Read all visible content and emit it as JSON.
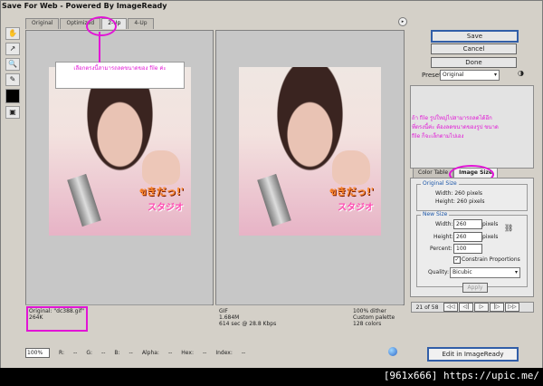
{
  "window": {
    "title": "Save For Web - Powered By ImageReady"
  },
  "tabs": [
    {
      "label": "Original"
    },
    {
      "label": "Optimized"
    },
    {
      "label": "2-Up"
    },
    {
      "label": "4-Up"
    }
  ],
  "buttons": {
    "save": "Save",
    "cancel": "Cancel",
    "done": "Done"
  },
  "preset": {
    "label": "Preset:",
    "value": "Original"
  },
  "annotations": {
    "left": "เลือกตรงนี้สามารถลดขนาดของ file ค่ะ",
    "right_lines": [
      "ถ้า file รูปใหญ่ไปสามารถลดได้อีก",
      "ที่ตรงนี้ค่ะ ต้องลดขนาดของรูป ขนาด",
      "file ก็จะเล็กตามไปเอง"
    ]
  },
  "left_image": {
    "overlay_text_1": "ขきだっ!'",
    "overlay_text_2": "スタジオ"
  },
  "right_image": {
    "overlay_text_1": "ขきだっ!'",
    "overlay_text_2": "スタジオ"
  },
  "info_left": {
    "line1": "Original: \"dc388.gif\"",
    "line2": "264K"
  },
  "info_right": {
    "col1": [
      "GIF",
      "1.684M",
      "614 sec @ 28.8 Kbps"
    ],
    "col2": [
      "100% dither",
      "Custom palette",
      "128 colors"
    ]
  },
  "side_tabs": [
    {
      "label": "Color Table"
    },
    {
      "label": "Image Size"
    }
  ],
  "image_size": {
    "original_legend": "Original Size",
    "original_width": "Width: 260 pixels",
    "original_height": "Height: 260 pixels",
    "new_legend": "New Size",
    "width_label": "Width:",
    "width_value": "260",
    "height_label": "Height:",
    "height_value": "260",
    "unit": "pixels",
    "percent_label": "Percent:",
    "percent_value": "100",
    "constrain_label": "Constrain Proportions",
    "quality_label": "Quality:",
    "quality_value": "Bicubic",
    "apply_label": "Apply"
  },
  "nav": {
    "frame_counter": "21 of 58"
  },
  "status_bar": {
    "zoom": "100%",
    "channels": [
      "R:",
      "--",
      "G:",
      "--",
      "B:",
      "--",
      "Alpha:",
      "--",
      "Hex:",
      "--",
      "Index:",
      "--"
    ]
  },
  "edit_button": "Edit in ImageReady",
  "credit": "[961x666] https://upic.me/",
  "colors": {
    "accent": "#e214d6",
    "window_bg": "#d4d0c8",
    "primary_border": "#315ea8"
  },
  "icons": [
    "hand-tool-icon",
    "slice-select-tool-icon",
    "zoom-tool-icon",
    "eyedropper-tool-icon",
    "foreground-swatch-icon",
    "toggle-slices-icon",
    "link-icon",
    "browser-preview-icon",
    "panel-menu-icon"
  ]
}
